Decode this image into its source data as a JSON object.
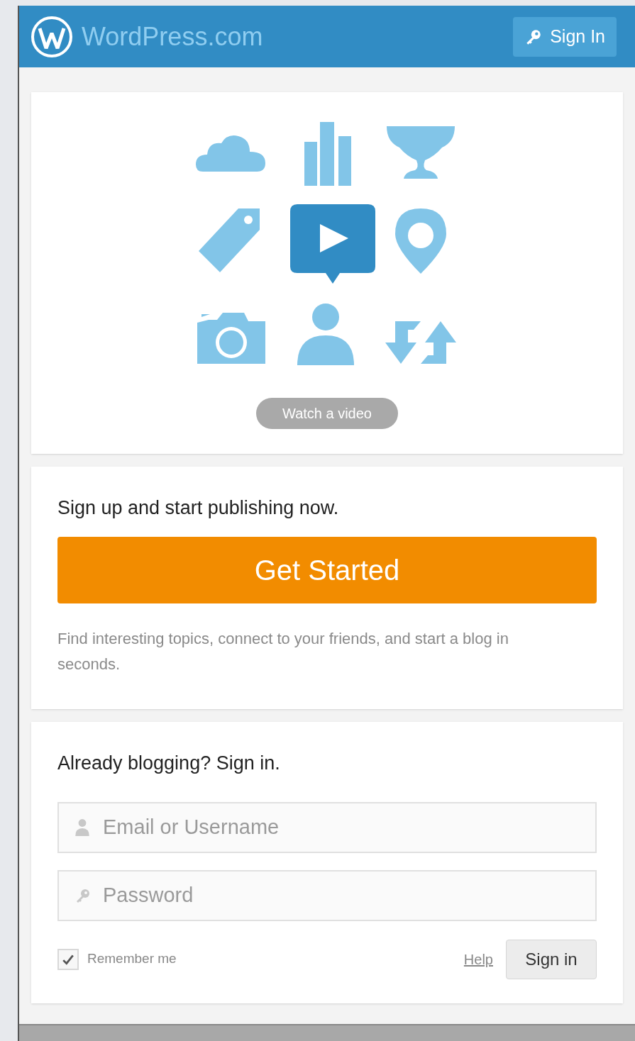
{
  "header": {
    "logo_text": "WordPress.com",
    "sign_in_button": "Sign In"
  },
  "intro": {
    "video_button": "Watch a video"
  },
  "signup": {
    "heading": "Sign up and start publishing now.",
    "button": "Get Started",
    "description": "Find interesting topics, connect to your friends, and start a blog in seconds."
  },
  "signin": {
    "heading": "Already blogging? Sign in.",
    "email_placeholder": "Email or Username",
    "password_placeholder": "Password",
    "remember": {
      "label": "Remember me",
      "checked": true
    },
    "help_link": "Help",
    "button": "Sign in"
  }
}
